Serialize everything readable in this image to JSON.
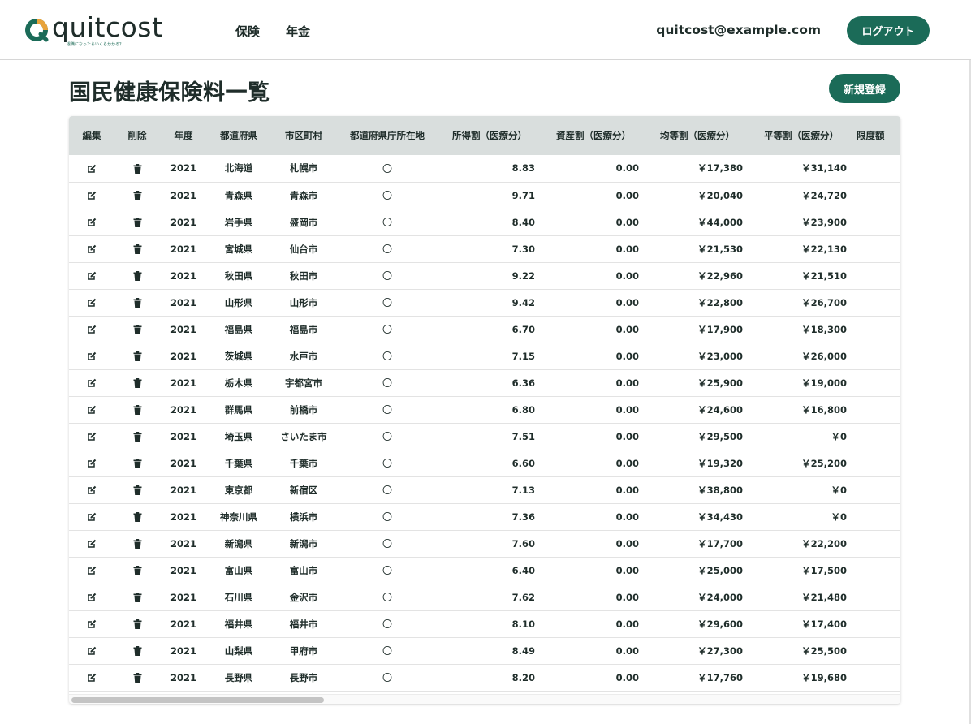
{
  "header": {
    "logo_text": "quitcost",
    "logo_tagline": "退職になったらいくらかかる？",
    "nav": [
      "保険",
      "年金"
    ],
    "user_email": "quitcost@example.com",
    "logout_label": "ログアウト"
  },
  "page": {
    "title": "国民健康保険料一覧",
    "new_button_label": "新規登録"
  },
  "table": {
    "columns": [
      "編集",
      "削除",
      "年度",
      "都道府県",
      "市区町村",
      "都道府県庁所在地",
      "所得割（医療分）",
      "資産割（医療分）",
      "均等割（医療分）",
      "平等割（医療分）",
      "限度額"
    ],
    "rows": [
      {
        "year": "2021",
        "prefecture": "北海道",
        "city": "札幌市",
        "capital": "〇",
        "income": "8.83",
        "asset": "0.00",
        "per_capita": "￥17,380",
        "per_household": "￥31,140"
      },
      {
        "year": "2021",
        "prefecture": "青森県",
        "city": "青森市",
        "capital": "〇",
        "income": "9.71",
        "asset": "0.00",
        "per_capita": "￥20,040",
        "per_household": "￥24,720"
      },
      {
        "year": "2021",
        "prefecture": "岩手県",
        "city": "盛岡市",
        "capital": "〇",
        "income": "8.40",
        "asset": "0.00",
        "per_capita": "￥44,000",
        "per_household": "￥23,900"
      },
      {
        "year": "2021",
        "prefecture": "宮城県",
        "city": "仙台市",
        "capital": "〇",
        "income": "7.30",
        "asset": "0.00",
        "per_capita": "￥21,530",
        "per_household": "￥22,130"
      },
      {
        "year": "2021",
        "prefecture": "秋田県",
        "city": "秋田市",
        "capital": "〇",
        "income": "9.22",
        "asset": "0.00",
        "per_capita": "￥22,960",
        "per_household": "￥21,510"
      },
      {
        "year": "2021",
        "prefecture": "山形県",
        "city": "山形市",
        "capital": "〇",
        "income": "9.42",
        "asset": "0.00",
        "per_capita": "￥22,800",
        "per_household": "￥26,700"
      },
      {
        "year": "2021",
        "prefecture": "福島県",
        "city": "福島市",
        "capital": "〇",
        "income": "6.70",
        "asset": "0.00",
        "per_capita": "￥17,900",
        "per_household": "￥18,300"
      },
      {
        "year": "2021",
        "prefecture": "茨城県",
        "city": "水戸市",
        "capital": "〇",
        "income": "7.15",
        "asset": "0.00",
        "per_capita": "￥23,000",
        "per_household": "￥26,000"
      },
      {
        "year": "2021",
        "prefecture": "栃木県",
        "city": "宇都宮市",
        "capital": "〇",
        "income": "6.36",
        "asset": "0.00",
        "per_capita": "￥25,900",
        "per_household": "￥19,000"
      },
      {
        "year": "2021",
        "prefecture": "群馬県",
        "city": "前橋市",
        "capital": "〇",
        "income": "6.80",
        "asset": "0.00",
        "per_capita": "￥24,600",
        "per_household": "￥16,800"
      },
      {
        "year": "2021",
        "prefecture": "埼玉県",
        "city": "さいたま市",
        "capital": "〇",
        "income": "7.51",
        "asset": "0.00",
        "per_capita": "￥29,500",
        "per_household": "￥0"
      },
      {
        "year": "2021",
        "prefecture": "千葉県",
        "city": "千葉市",
        "capital": "〇",
        "income": "6.60",
        "asset": "0.00",
        "per_capita": "￥19,320",
        "per_household": "￥25,200"
      },
      {
        "year": "2021",
        "prefecture": "東京都",
        "city": "新宿区",
        "capital": "〇",
        "income": "7.13",
        "asset": "0.00",
        "per_capita": "￥38,800",
        "per_household": "￥0"
      },
      {
        "year": "2021",
        "prefecture": "神奈川県",
        "city": "横浜市",
        "capital": "〇",
        "income": "7.36",
        "asset": "0.00",
        "per_capita": "￥34,430",
        "per_household": "￥0"
      },
      {
        "year": "2021",
        "prefecture": "新潟県",
        "city": "新潟市",
        "capital": "〇",
        "income": "7.60",
        "asset": "0.00",
        "per_capita": "￥17,700",
        "per_household": "￥22,200"
      },
      {
        "year": "2021",
        "prefecture": "富山県",
        "city": "富山市",
        "capital": "〇",
        "income": "6.40",
        "asset": "0.00",
        "per_capita": "￥25,000",
        "per_household": "￥17,500"
      },
      {
        "year": "2021",
        "prefecture": "石川県",
        "city": "金沢市",
        "capital": "〇",
        "income": "7.62",
        "asset": "0.00",
        "per_capita": "￥24,000",
        "per_household": "￥21,480"
      },
      {
        "year": "2021",
        "prefecture": "福井県",
        "city": "福井市",
        "capital": "〇",
        "income": "8.10",
        "asset": "0.00",
        "per_capita": "￥29,600",
        "per_household": "￥17,400"
      },
      {
        "year": "2021",
        "prefecture": "山梨県",
        "city": "甲府市",
        "capital": "〇",
        "income": "8.49",
        "asset": "0.00",
        "per_capita": "￥27,300",
        "per_household": "￥25,500"
      },
      {
        "year": "2021",
        "prefecture": "長野県",
        "city": "長野市",
        "capital": "〇",
        "income": "8.20",
        "asset": "0.00",
        "per_capita": "￥17,760",
        "per_household": "￥19,680"
      }
    ]
  },
  "icons": {
    "edit": "edit-icon",
    "delete": "trash-icon"
  },
  "colors": {
    "brand_green": "#1b6b58",
    "logo_orange": "#e8a33a",
    "header_row_bg": "#d9dedd"
  }
}
